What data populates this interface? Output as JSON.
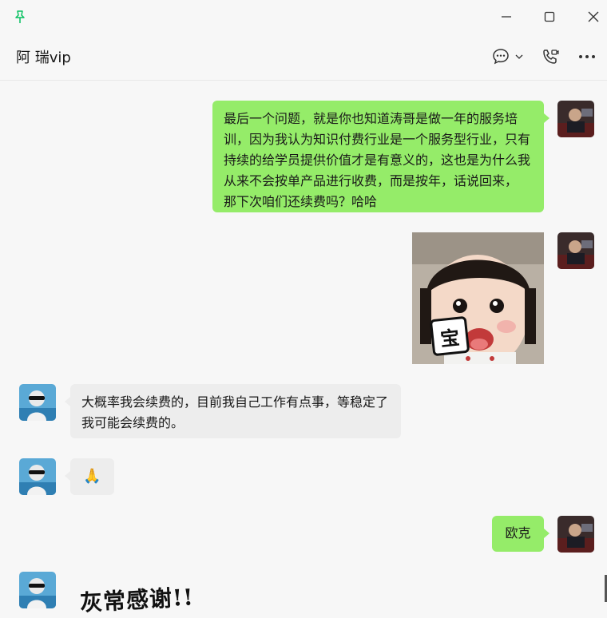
{
  "window": {
    "title": "阿 瑞vip",
    "controls": [
      "minimize-icon",
      "maximize-icon",
      "close-icon"
    ]
  },
  "header": {
    "pin_icon": "pin-icon",
    "icons": [
      "chat-bubble-icon",
      "chevron-down-icon",
      "video-call-icon",
      "more-icon"
    ]
  },
  "colors": {
    "my_bubble": "#95ec69",
    "their_bubble": "#ededed",
    "background": "#f7f7f7",
    "pin": "#07c160"
  },
  "messages": [
    {
      "from": "me",
      "type": "text",
      "text": "最后一个问题，就是你也知道涛哥是做一年的服务培训，因为我认为知识付费行业是一个服务型行业，只有持续的给学员提供价值才是有意义的，这也是为什么我从来不会按单产品进行收费，而是按年，话说回来， 那下次咱们还续费吗？哈哈"
    },
    {
      "from": "me",
      "type": "sticker",
      "caption": "宝"
    },
    {
      "from": "other",
      "type": "text",
      "text": "大概率我会续费的，目前我自己工作有点事，等稳定了我可能会续费的。"
    },
    {
      "from": "other",
      "type": "emoji",
      "text": "🙏"
    },
    {
      "from": "me",
      "type": "text",
      "text": "欧克"
    },
    {
      "from": "other",
      "type": "sticker",
      "caption": "灰常感谢!!"
    }
  ]
}
